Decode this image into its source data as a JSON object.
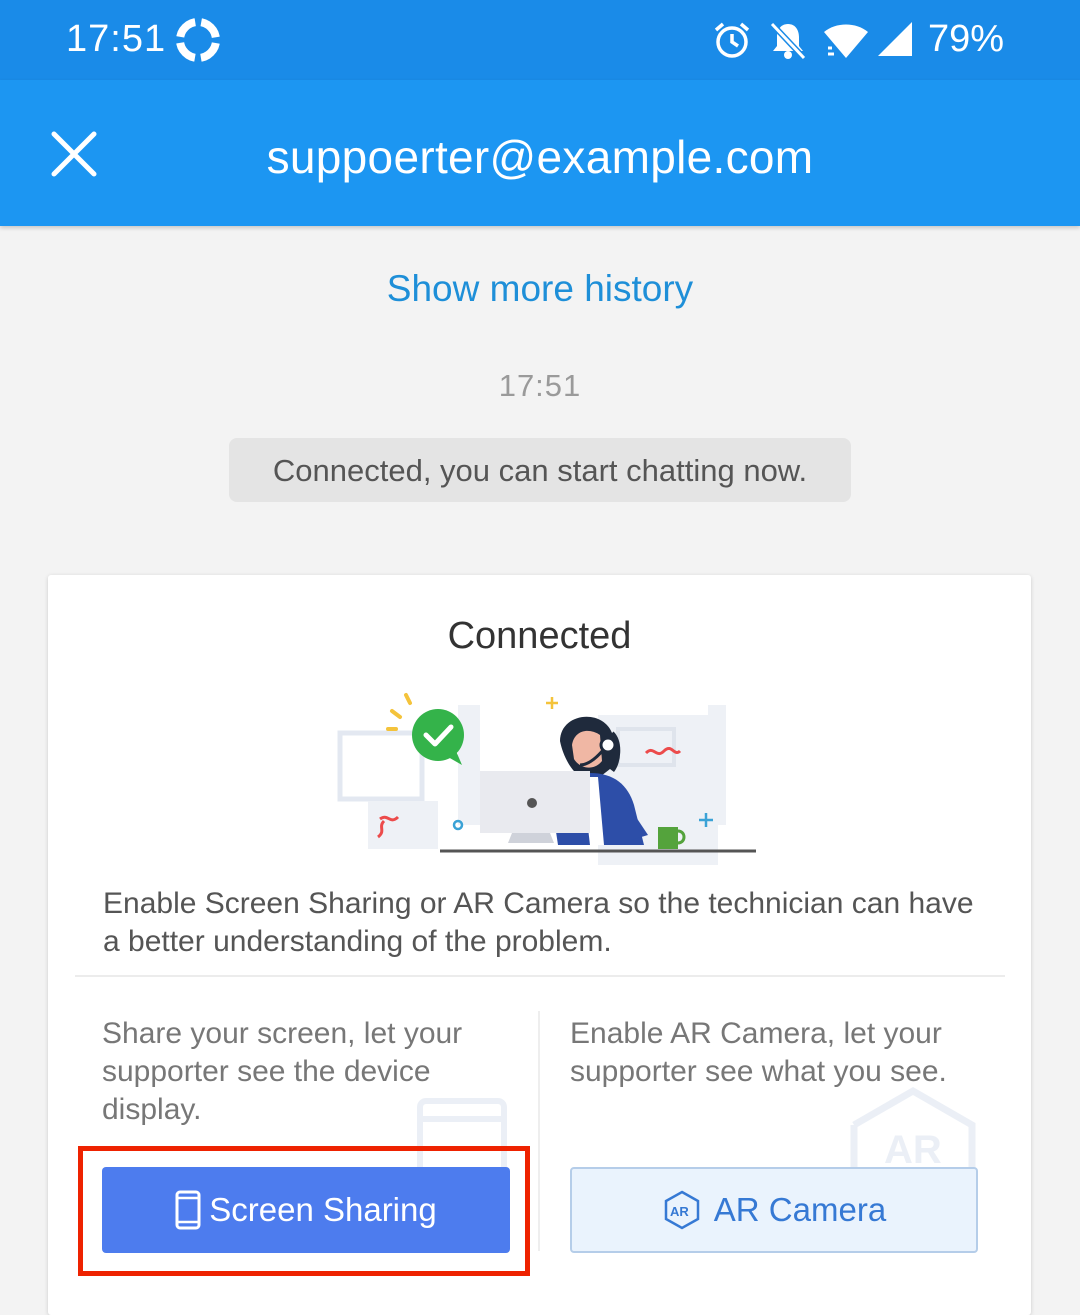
{
  "status_bar": {
    "time": "17:51",
    "battery": "79%",
    "icons": [
      "lifebuoy-icon",
      "alarm-icon",
      "bell-off-icon",
      "wifi-icon",
      "signal-icon"
    ]
  },
  "header": {
    "title": "suppoerter@example.com",
    "close_icon": "close-icon"
  },
  "chat": {
    "show_more_history": "Show more history",
    "timestamp": "17:51",
    "system_message": "Connected, you can start chatting now."
  },
  "card": {
    "title": "Connected",
    "description": "Enable Screen Sharing or AR Camera so the technician can have a better understanding of the problem.",
    "screen_option": {
      "text": "Share your screen, let your supporter see the device display.",
      "button_label": "Screen Sharing",
      "button_icon": "phone-icon"
    },
    "ar_option": {
      "text": "Enable AR Camera, let your supporter see what you see.",
      "button_label": "AR Camera",
      "button_icon": "ar-icon"
    }
  },
  "colors": {
    "status_bar": "#1a8be8",
    "app_bar": "#1c96f2",
    "link": "#1e8fd8",
    "primary_button": "#4d7cee",
    "secondary_button_bg": "#eaf3fd",
    "highlight": "#ee2200"
  }
}
